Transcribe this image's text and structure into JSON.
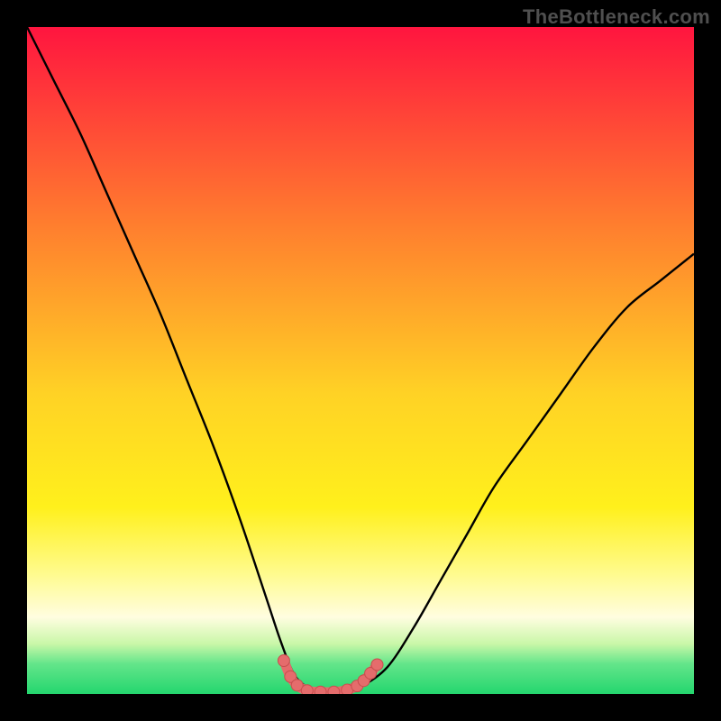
{
  "watermark": "TheBottleneck.com",
  "colors": {
    "frame": "#000000",
    "gradient_top": "#ff153f",
    "gradient_mid_upper": "#ff8a2a",
    "gradient_mid": "#ffe824",
    "gradient_pale": "#fffccb",
    "gradient_green": "#36e27a",
    "curve": "#000000",
    "marker_fill": "#e56c6c",
    "marker_stroke": "#c74e4e"
  },
  "chart_data": {
    "type": "line",
    "title": "",
    "xlabel": "",
    "ylabel": "",
    "xlim": [
      0,
      100
    ],
    "ylim": [
      0,
      100
    ],
    "series": [
      {
        "name": "bottleneck-curve",
        "x": [
          0,
          4,
          8,
          12,
          16,
          20,
          24,
          28,
          32,
          36,
          38,
          40,
          42,
          44,
          46,
          48,
          50,
          54,
          58,
          62,
          66,
          70,
          75,
          80,
          85,
          90,
          95,
          100
        ],
        "y": [
          100,
          92,
          84,
          75,
          66,
          57,
          47,
          37,
          26,
          14,
          8,
          3,
          1,
          0,
          0,
          0,
          1,
          4,
          10,
          17,
          24,
          31,
          38,
          45,
          52,
          58,
          62,
          66
        ]
      }
    ],
    "markers": {
      "name": "highlight-points",
      "x": [
        38.5,
        39.5,
        40.5,
        42,
        44,
        46,
        48,
        49.5,
        50.5,
        51.5,
        52.5
      ],
      "y": [
        5.0,
        2.6,
        1.3,
        0.5,
        0.3,
        0.3,
        0.6,
        1.2,
        2.0,
        3.1,
        4.4
      ]
    },
    "gradient_stops": [
      {
        "offset": 0.0,
        "color": "#ff153f"
      },
      {
        "offset": 0.3,
        "color": "#ff7f2e"
      },
      {
        "offset": 0.55,
        "color": "#ffd225"
      },
      {
        "offset": 0.72,
        "color": "#fff01c"
      },
      {
        "offset": 0.82,
        "color": "#fffb8e"
      },
      {
        "offset": 0.885,
        "color": "#fffde0"
      },
      {
        "offset": 0.925,
        "color": "#c9f7a8"
      },
      {
        "offset": 0.955,
        "color": "#63e58a"
      },
      {
        "offset": 1.0,
        "color": "#24d66e"
      }
    ]
  }
}
